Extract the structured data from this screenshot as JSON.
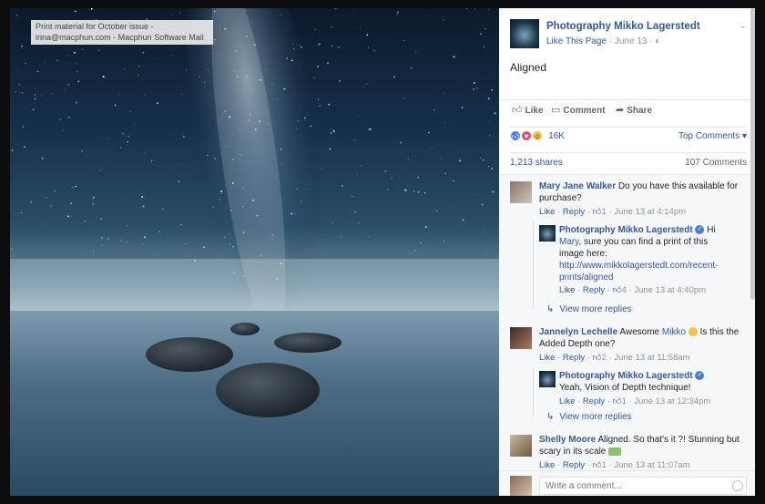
{
  "source_tag": {
    "line1": "Print material for October issue -",
    "line2": "irina@macphun.com - Macphun Software Mail"
  },
  "post": {
    "page_name": "Photography Mikko Lagerstedt",
    "like_page": "Like This Page",
    "date": "June 13",
    "text": "Aligned",
    "actions": {
      "like": "Like",
      "comment": "Comment",
      "share": "Share"
    },
    "reaction_count": "16K",
    "top_comments": "Top Comments",
    "shares": "1,213 shares",
    "comments_count": "107 Comments"
  },
  "comments": [
    {
      "author": "Mary Jane Walker",
      "text": " Do you have this available for purchase?",
      "like": "Like",
      "reply": "Reply",
      "likes": "1",
      "time": "June 13 at 4:14pm",
      "reply_item": {
        "author": "Photography Mikko Lagerstedt",
        "text_pre": " Hi ",
        "mention": "Mary",
        "text_post": ", sure you can find a print of this image here:",
        "link": "http://www.mikkolagerstedt.com/recent-prints/aligned",
        "like": "Like",
        "reply": "Reply",
        "likes": "4",
        "time": "June 13 at 4:40pm"
      },
      "view_more": "View more replies"
    },
    {
      "author": "Jannelyn Lechelle",
      "text_pre": " Awesome ",
      "mention": "Mikko",
      "text_post": " Is this the Added Depth one?",
      "like": "Like",
      "reply": "Reply",
      "likes": "2",
      "time": "June 13 at 11:58am",
      "reply_item": {
        "author": "Photography Mikko Lagerstedt",
        "text": " Yeah, Vision of Depth technique!",
        "like": "Like",
        "reply": "Reply",
        "likes": "1",
        "time": "June 13 at 12:34pm"
      },
      "view_more": "View more replies"
    },
    {
      "author": "Shelly Moore",
      "text": " Aligned. So that's it ?! Stunning but scary in its scale",
      "like": "Like",
      "reply": "Reply",
      "likes": "1",
      "time": "June 13 at 11:07am"
    }
  ],
  "write_comment": {
    "placeholder": "Write a comment..."
  },
  "icons": {
    "like": "thumbs-up-icon",
    "comment": "speech-bubble-icon",
    "share": "share-arrow-icon",
    "globe": "globe-icon",
    "chevron": "chevron-down-icon",
    "reply_arrow": "reply-arrow-icon",
    "smile": "smile-icon"
  },
  "colors": {
    "link": "#365899",
    "muted": "#90949c",
    "like_blue": "#4a7cdb",
    "love_red": "#ea4b6f",
    "wow_yellow": "#f3c14c"
  }
}
